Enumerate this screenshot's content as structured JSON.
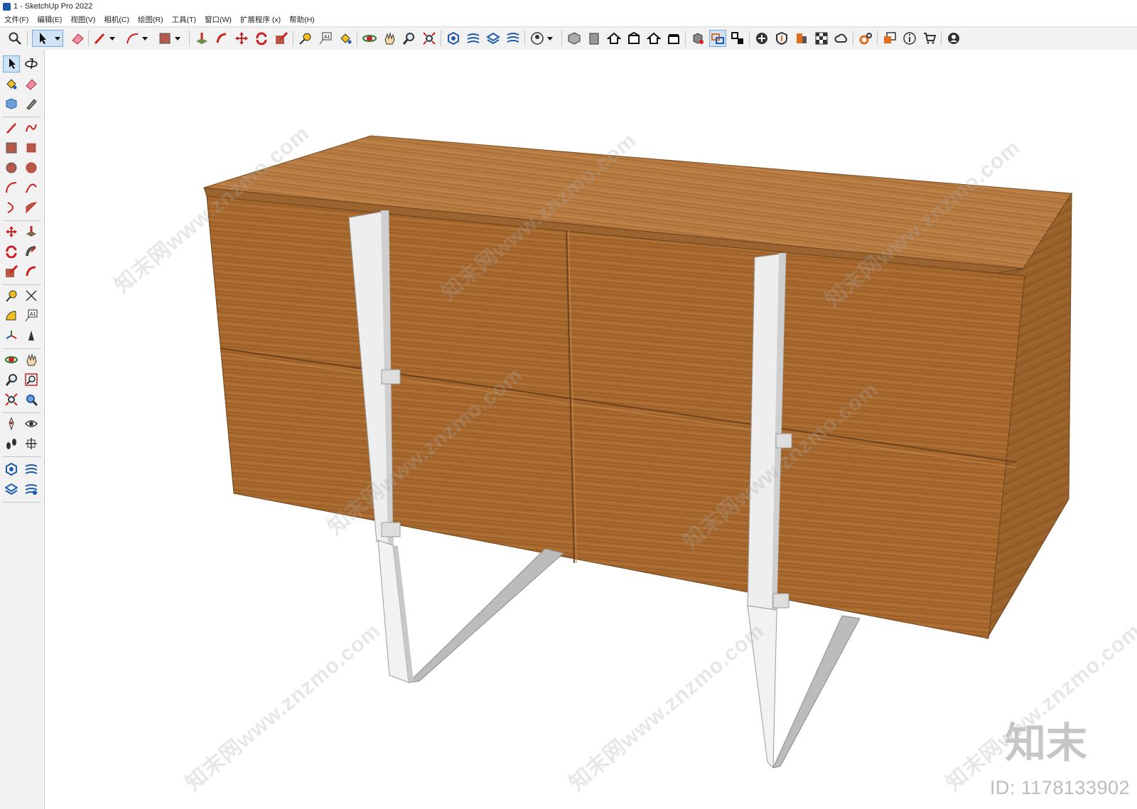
{
  "window": {
    "title": "1 - SketchUp Pro 2022"
  },
  "menu": [
    "文件(F)",
    "编辑(E)",
    "视图(V)",
    "相机(C)",
    "绘图(R)",
    "工具(T)",
    "窗口(W)",
    "扩展程序 (x)",
    "帮助(H)"
  ],
  "watermark": {
    "site": "知末网www.znzmo.com",
    "logo": "知末",
    "id": "ID: 1178133902"
  },
  "colors": {
    "wood_top": "#b87c43",
    "wood_front": "#a8692f",
    "wood_side": "#98602a",
    "metal": "#e6e6e6",
    "metal_shadow": "#b9b9b9",
    "accent_red": "#d4262c",
    "accent_blue": "#1e5aa8",
    "accent_active": "#cfe3f7"
  },
  "toolbar_icons": [
    "search-icon",
    "select-icon",
    "eraser-icon",
    "pencil-icon",
    "arc-icon",
    "rectangle-icon",
    "push-pull-icon",
    "follow-me-icon",
    "move-icon",
    "rotate-icon",
    "scale-icon",
    "tape-measure-icon",
    "text-icon",
    "paint-bucket-icon",
    "orbit-icon",
    "pan-icon",
    "zoom-icon",
    "zoom-extents-icon",
    "solid-tools-icon",
    "sandbox-icon",
    "warehouse-icon",
    "layers-icon",
    "user-icon",
    "iso-view-icon",
    "front-view-icon",
    "home-view-icon",
    "back-view-icon",
    "left-view-icon",
    "right-view-icon",
    "component-icon",
    "selected-icon",
    "dimension-icon",
    "add-icon",
    "section-icon",
    "scene-icon",
    "style-icon",
    "cloud-icon",
    "settings-icon",
    "window-icon",
    "info-icon",
    "cart-icon",
    "account-icon"
  ],
  "left_icons": [
    "select-icon",
    "orbit-icon",
    "paint-bucket-icon",
    "eraser-icon",
    "component-icon",
    "tape-icon",
    "pencil-icon",
    "freehand-icon",
    "rectangle-icon",
    "rotated-rectangle-icon",
    "circle-icon",
    "polygon-icon",
    "arc-icon",
    "two-point-arc-icon",
    "three-point-arc-icon",
    "pie-icon",
    "move-icon",
    "push-pull-icon",
    "rotate-icon",
    "follow-me-icon",
    "scale-icon",
    "offset-icon",
    "tape-measure-icon",
    "dimension-icon",
    "protractor-icon",
    "text-icon",
    "axes-icon",
    "3d-text-icon",
    "orbit2-icon",
    "pan-icon",
    "zoom-icon",
    "zoom-window-icon",
    "zoom-extents-icon",
    "previous-view-icon",
    "position-camera-icon",
    "look-around-icon",
    "walk-icon",
    "section-plane-icon",
    "sandbox-icon",
    "smoove-icon",
    "stamp-icon",
    "drape-icon"
  ]
}
